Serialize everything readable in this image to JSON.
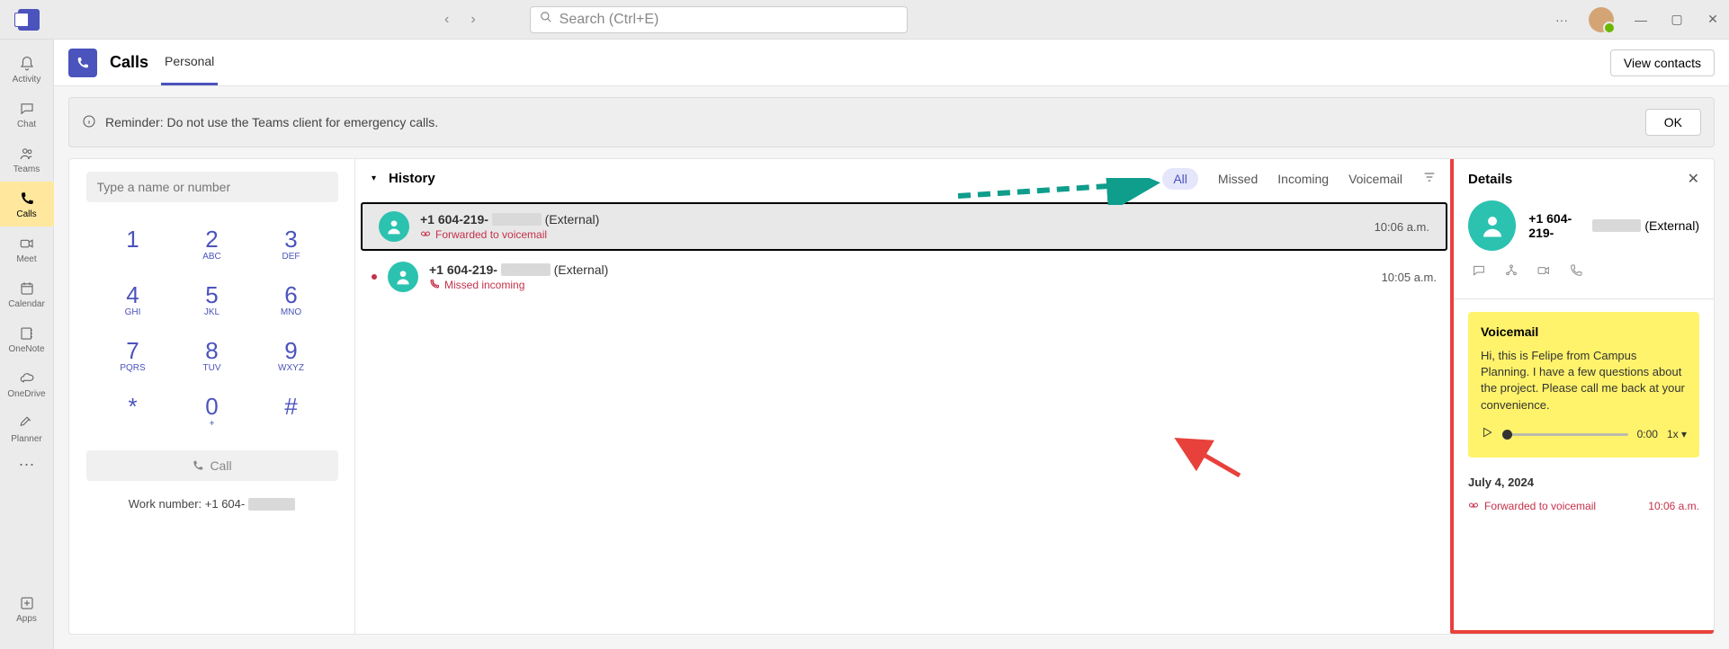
{
  "titlebar": {
    "search_placeholder": "Search (Ctrl+E)"
  },
  "rail": {
    "items": [
      {
        "icon": "bell",
        "label": "Activity"
      },
      {
        "icon": "chat",
        "label": "Chat"
      },
      {
        "icon": "teams",
        "label": "Teams"
      },
      {
        "icon": "calls",
        "label": "Calls"
      },
      {
        "icon": "meet",
        "label": "Meet"
      },
      {
        "icon": "calendar",
        "label": "Calendar"
      },
      {
        "icon": "onenote",
        "label": "OneNote"
      },
      {
        "icon": "cloud",
        "label": "OneDrive"
      },
      {
        "icon": "planner",
        "label": "Planner"
      }
    ],
    "apps_label": "Apps"
  },
  "page": {
    "title": "Calls",
    "tab_personal": "Personal",
    "view_contacts": "View contacts"
  },
  "banner": {
    "text": "Reminder: Do not use the Teams client for emergency calls.",
    "ok": "OK"
  },
  "dialer": {
    "input_placeholder": "Type a name or number",
    "keys": [
      {
        "n": "1",
        "s": ""
      },
      {
        "n": "2",
        "s": "ABC"
      },
      {
        "n": "3",
        "s": "DEF"
      },
      {
        "n": "4",
        "s": "GHI"
      },
      {
        "n": "5",
        "s": "JKL"
      },
      {
        "n": "6",
        "s": "MNO"
      },
      {
        "n": "7",
        "s": "PQRS"
      },
      {
        "n": "8",
        "s": "TUV"
      },
      {
        "n": "9",
        "s": "WXYZ"
      },
      {
        "n": "*",
        "s": ""
      },
      {
        "n": "0",
        "s": "+"
      },
      {
        "n": "#",
        "s": ""
      }
    ],
    "call": "Call",
    "worknum_label": "Work number: +1 604-"
  },
  "history": {
    "title": "History",
    "filters": {
      "all": "All",
      "missed": "Missed",
      "incoming": "Incoming",
      "voicemail": "Voicemail"
    },
    "rows": [
      {
        "number": "+1 604-219-",
        "ext": "(External)",
        "sub": "Forwarded to voicemail",
        "sub_icon": "voicemail",
        "red": true,
        "time": "10:06 a.m.",
        "selected": true,
        "dot": false
      },
      {
        "number": "+1 604-219-",
        "ext": "(External)",
        "sub": "Missed incoming",
        "sub_icon": "missed",
        "red": true,
        "time": "10:05 a.m.",
        "selected": false,
        "dot": true
      }
    ]
  },
  "details": {
    "title": "Details",
    "number": "+1 604-219-",
    "ext": "(External)",
    "voicemail_title": "Voicemail",
    "transcript": "Hi, this is Felipe from Campus Planning. I have a few questions about the project. Please call me back at your convenience.",
    "duration": "0:00",
    "speed": "1x",
    "date": "July 4, 2024",
    "entry_label": "Forwarded to voicemail",
    "entry_time": "10:06 a.m."
  }
}
